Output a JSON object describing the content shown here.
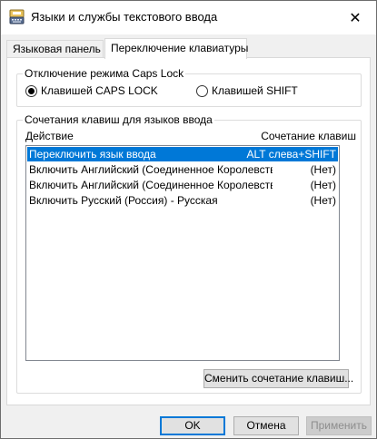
{
  "window": {
    "title": "Языки и службы текстового ввода",
    "app_icon": "keyboard-language-icon",
    "close_glyph": "✕"
  },
  "tabs": [
    {
      "label": "Языковая панель",
      "active": false
    },
    {
      "label": "Переключение клавиатуры",
      "active": true
    }
  ],
  "caps_lock_group": {
    "title": "Отключение режима Caps Lock",
    "options": [
      {
        "label": "Клавишей CAPS LOCK",
        "checked": true
      },
      {
        "label": "Клавишей SHIFT",
        "checked": false
      }
    ]
  },
  "hotkeys_group": {
    "title": "Сочетания клавиш для языков ввода",
    "columns": {
      "action": "Действие",
      "keys": "Сочетание клавиш"
    },
    "rows": [
      {
        "action": "Переключить язык ввода",
        "keys": "ALT слева+SHIFT",
        "selected": true
      },
      {
        "action": "Включить Английский (Соединенное Королевство) - США",
        "keys": "(Нет)",
        "selected": false
      },
      {
        "action": "Включить Английский (Соединенное Королевство) - СШ...",
        "keys": "(Нет)",
        "selected": false
      },
      {
        "action": "Включить Русский (Россия) - Русская",
        "keys": "(Нет)",
        "selected": false
      }
    ],
    "change_button": "Сменить сочетание клавиш..."
  },
  "footer": {
    "ok": "OK",
    "cancel": "Отмена",
    "apply": "Применить"
  },
  "colors": {
    "selection": "#0078d7",
    "default_button_border": "#0078d7",
    "disabled_text": "#8d8d8d"
  }
}
